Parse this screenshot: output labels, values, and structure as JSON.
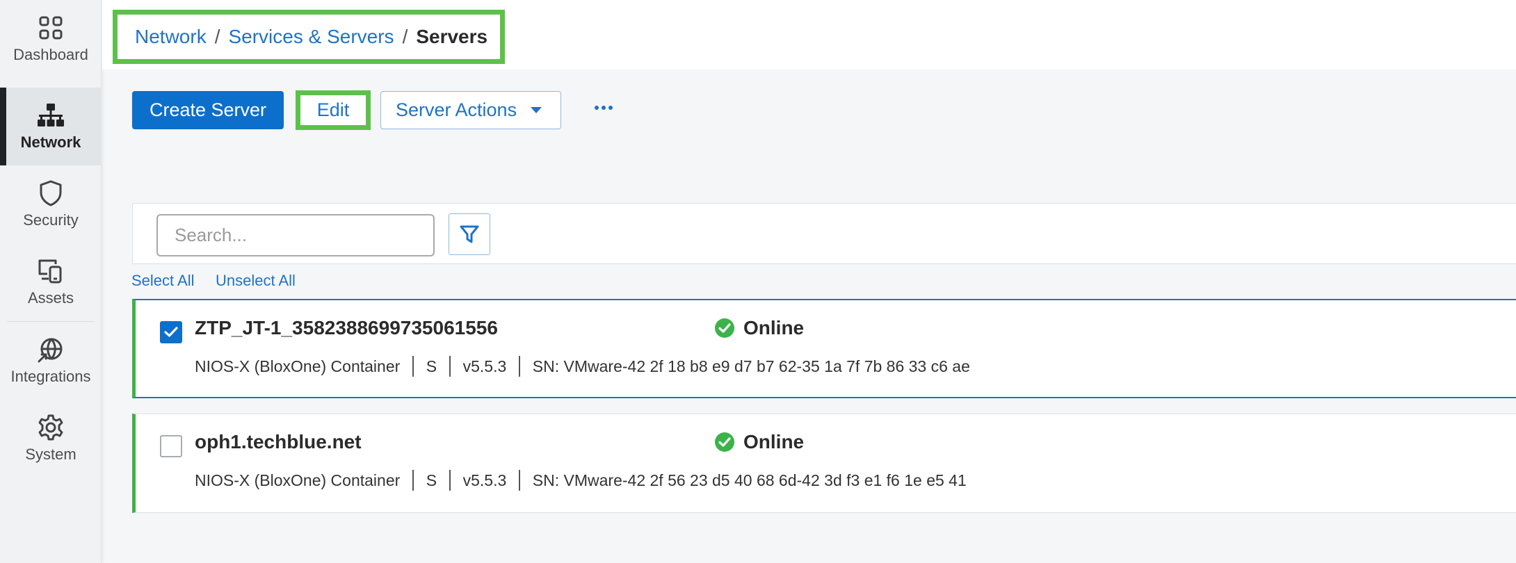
{
  "sidebar": {
    "items": [
      {
        "label": "Dashboard",
        "icon": "dashboard-icon"
      },
      {
        "label": "Network",
        "icon": "network-icon",
        "active": true
      },
      {
        "label": "Security",
        "icon": "shield-icon"
      },
      {
        "label": "Assets",
        "icon": "assets-icon"
      },
      {
        "label": "Integrations",
        "icon": "integrations-icon"
      },
      {
        "label": "System",
        "icon": "gear-icon"
      }
    ]
  },
  "breadcrumb": {
    "items": [
      "Network",
      "Services & Servers"
    ],
    "separator": "/",
    "current": "Servers"
  },
  "toolbar": {
    "create_label": "Create Server",
    "edit_label": "Edit",
    "actions_label": "Server Actions",
    "more_icon": "more-horizontal-icon"
  },
  "search": {
    "placeholder": "Search...",
    "value": "",
    "filter_icon": "filter-icon"
  },
  "selection": {
    "select_all": "Select All",
    "unselect_all": "Unselect All"
  },
  "servers": [
    {
      "name": "ZTP_JT-1_3582388699735061556",
      "status": "Online",
      "selected": true,
      "type": "NIOS-X (BloxOne) Container",
      "size": "S",
      "version": "v5.5.3",
      "serial": "SN: VMware-42 2f 18 b8 e9 d7 b7 62-35 1a 7f 7b 86 33 c6 ae"
    },
    {
      "name": "oph1.techblue.net",
      "status": "Online",
      "selected": false,
      "type": "NIOS-X (BloxOne) Container",
      "size": "S",
      "version": "v5.5.3",
      "serial": "SN: VMware-42 2f 56 23 d5 40 68 6d-42 3d f3 e1 f6 1e e5 41"
    }
  ],
  "colors": {
    "primary": "#0c6fcb",
    "link": "#1e73c5",
    "highlight": "#5cc14a",
    "online": "#3cb34a"
  }
}
